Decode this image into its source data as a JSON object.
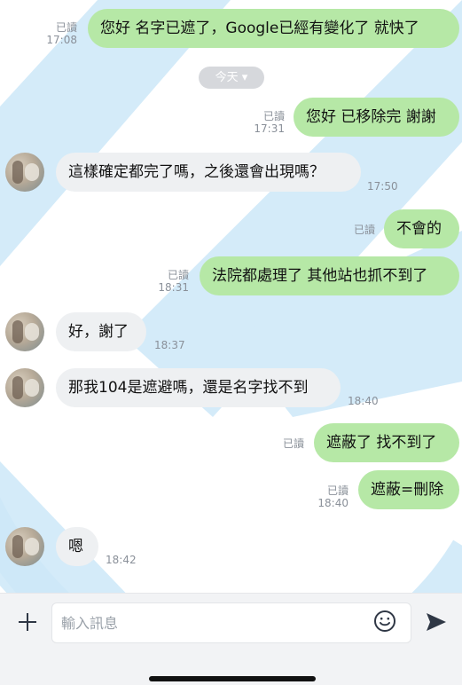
{
  "chat": {
    "date_divider": "今天 ▾",
    "messages": [
      {
        "side": "out",
        "text": "您好 名字已遮了，Google已經有變化了 就快了",
        "read": "已讀",
        "time": "17:08"
      },
      {
        "side": "out",
        "text": "您好 已移除完 謝謝",
        "read": "已讀",
        "time": "17:31"
      },
      {
        "side": "in",
        "text": "這樣確定都完了嗎，之後還會出現嗎？",
        "time": "17:50"
      },
      {
        "side": "out",
        "text": "不會的",
        "read": "已讀",
        "time": ""
      },
      {
        "side": "out",
        "text": "法院都處理了 其他站也抓不到了",
        "read": "已讀",
        "time": "18:31"
      },
      {
        "side": "in",
        "text": "好，謝了",
        "time": "18:37"
      },
      {
        "side": "in",
        "text": "那我104是遮避嗎，還是名字找不到",
        "time": "18:40"
      },
      {
        "side": "out",
        "text": "遮蔽了 找不到了",
        "read": "已讀",
        "time": ""
      },
      {
        "side": "out",
        "text": "遮蔽=刪除",
        "read": "已讀",
        "time": "18:40"
      },
      {
        "side": "in",
        "text": "嗯",
        "time": "18:42"
      }
    ]
  },
  "composer": {
    "placeholder": "輸入訊息",
    "icons": {
      "add": "plus-icon",
      "emoji": "smiley-icon",
      "send": "send-icon"
    }
  },
  "colors": {
    "outgoing": "#b6e8a6",
    "incoming": "#eef0f2",
    "watermark": "#cde8f8"
  }
}
